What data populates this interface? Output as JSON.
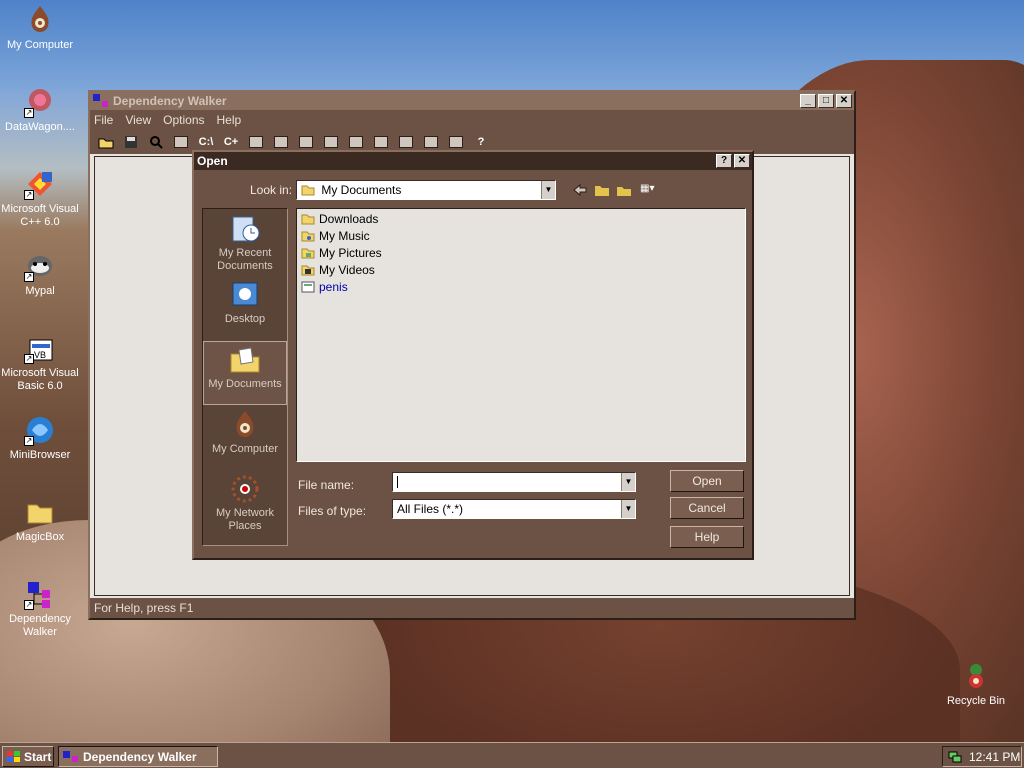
{
  "desktop": {
    "icons": [
      {
        "label": "My Computer",
        "icon": "my-computer-icon"
      },
      {
        "label": "DataWagon....",
        "icon": "datawagon-icon"
      },
      {
        "label": "Microsoft Visual C++ 6.0",
        "icon": "visual-cpp-icon"
      },
      {
        "label": "Mypal",
        "icon": "mypal-icon"
      },
      {
        "label": "Microsoft Visual Basic 6.0",
        "icon": "visual-basic-icon"
      },
      {
        "label": "MiniBrowser",
        "icon": "minibrowser-icon"
      },
      {
        "label": "MagicBox",
        "icon": "folder-icon"
      },
      {
        "label": "Dependency Walker",
        "icon": "dependency-walker-icon"
      },
      {
        "label": "Recycle Bin",
        "icon": "recycle-bin-icon"
      }
    ]
  },
  "main_window": {
    "title": "Dependency Walker",
    "menu": [
      "File",
      "View",
      "Options",
      "Help"
    ],
    "status": "For Help, press F1",
    "toolbar_buttons": [
      "open-icon",
      "save-icon",
      "find-icon",
      "copy-icon",
      "c-drive-icon",
      "cpp-icon",
      "print-icon",
      "properties-icon",
      "module-icon",
      "path-icon",
      "expand-icon",
      "collapse-icon",
      "tile-icon",
      "cascade-icon",
      "list-icon",
      "help-icon"
    ]
  },
  "open_dialog": {
    "title": "Open",
    "look_in_label": "Look in:",
    "look_in_value": "My Documents",
    "places": [
      {
        "label": "My Recent Documents",
        "icon": "recent-documents-icon"
      },
      {
        "label": "Desktop",
        "icon": "desktop-icon"
      },
      {
        "label": "My Documents",
        "icon": "my-documents-icon"
      },
      {
        "label": "My Computer",
        "icon": "my-computer-icon"
      },
      {
        "label": "My Network Places",
        "icon": "network-places-icon"
      }
    ],
    "files": [
      {
        "name": "Downloads",
        "icon": "folder-icon"
      },
      {
        "name": "My Music",
        "icon": "music-folder-icon"
      },
      {
        "name": "My Pictures",
        "icon": "pictures-folder-icon"
      },
      {
        "name": "My Videos",
        "icon": "videos-folder-icon"
      },
      {
        "name": "penis",
        "icon": "file-icon"
      }
    ],
    "file_name_label": "File name:",
    "file_name_value": "",
    "files_of_type_label": "Files of type:",
    "files_of_type_value": "All Files (*.*)",
    "open_label": "Open",
    "cancel_label": "Cancel",
    "help_label": "Help"
  },
  "taskbar": {
    "start_label": "Start",
    "task_label": "Dependency Walker",
    "clock": "12:41 PM"
  }
}
